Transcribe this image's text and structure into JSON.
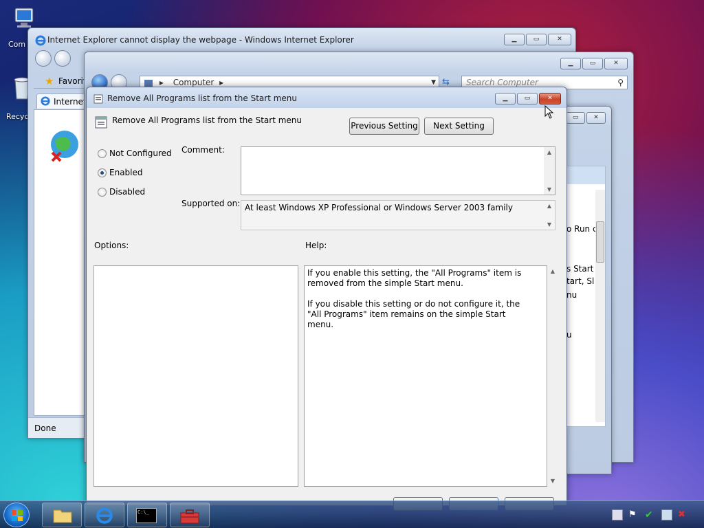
{
  "desktop": {
    "icons": [
      {
        "label": "Com"
      },
      {
        "label": "Recyc"
      }
    ]
  },
  "ie_window": {
    "title": "Internet Explorer cannot display the webpage - Windows Internet Explorer",
    "favorites_label": "Favorit",
    "tab_label": "Internet",
    "status_text": "Done"
  },
  "explorer_window": {
    "address_text": "Computer",
    "search_placeholder": "Search Computer"
  },
  "back_window": {
    "fragments": [
      "o Run c",
      "s Start N",
      "tart, Sl",
      "nu",
      "u"
    ]
  },
  "dialog": {
    "title": "Remove All Programs list from the Start menu",
    "policy_name": "Remove All Programs list from the Start menu",
    "prev_button": "Previous Setting",
    "next_button": "Next Setting",
    "radio_not_configured": "Not Configured",
    "radio_enabled": "Enabled",
    "radio_disabled": "Disabled",
    "comment_label": "Comment:",
    "supported_label": "Supported on:",
    "supported_value": "At least Windows XP Professional or Windows Server 2003 family",
    "options_label": "Options:",
    "help_label": "Help:",
    "help_text": "If you enable this setting, the \"All Programs\" item is removed from the simple Start menu.\n\nIf you disable this setting or do not configure it, the \"All Programs\" item remains on the simple Start menu."
  }
}
